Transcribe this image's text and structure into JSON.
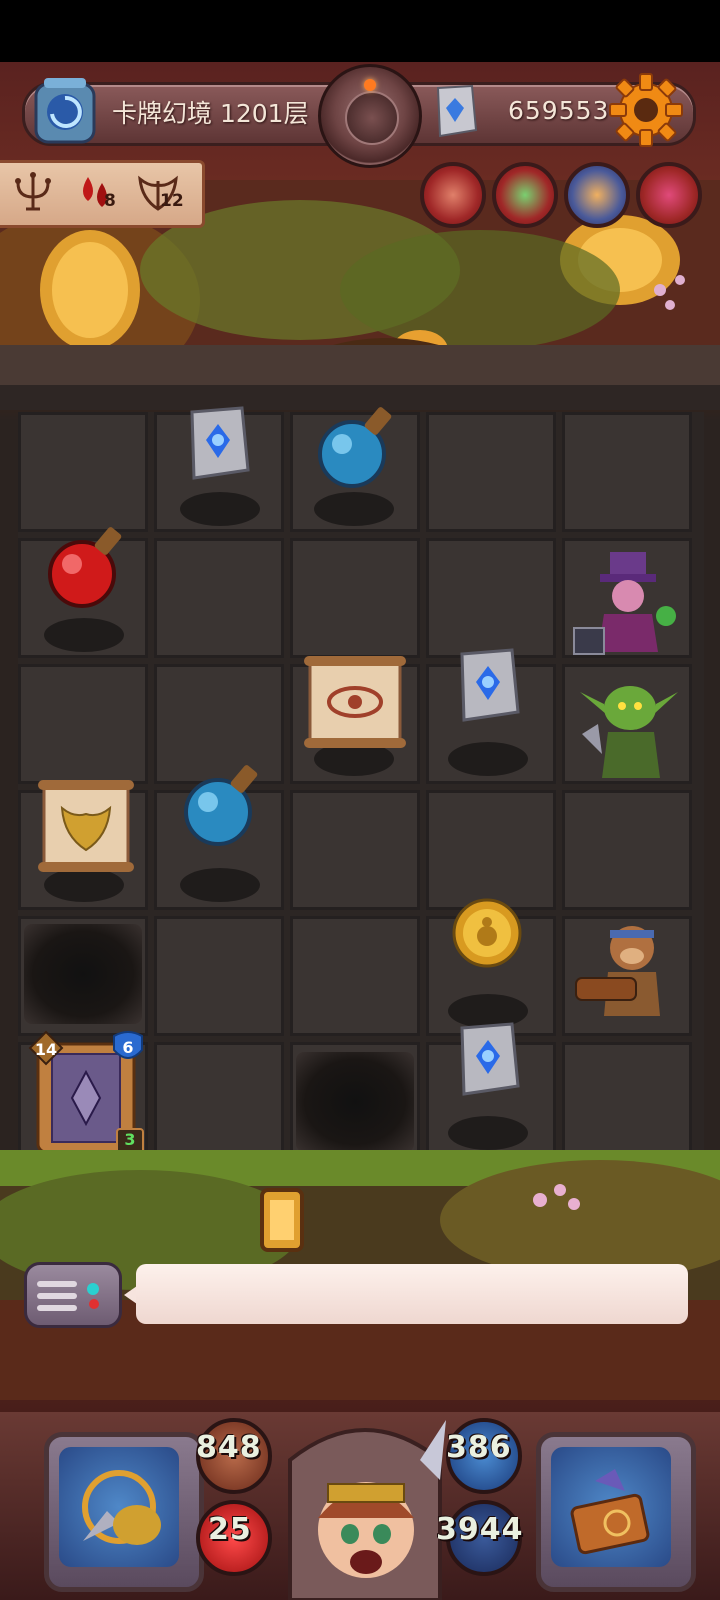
{
  "header": {
    "level_title": "卡牌幻境 1201层",
    "currency_value": "659553"
  },
  "resources": {
    "blood_count": "8",
    "wings_count": "12"
  },
  "heroes_top": [
    "hero-portrait-1",
    "hero-portrait-2",
    "hero-portrait-3",
    "hero-portrait-4"
  ],
  "deck_card": {
    "attack": "14",
    "shield": "6",
    "count": "3"
  },
  "player_stats": {
    "attack": "848",
    "defense": "386",
    "hp": "25",
    "gold": "3944"
  },
  "chat": {
    "message": ""
  },
  "colors": {
    "attack_orb": "#8a3a2a",
    "defense_orb": "#2e5a8a",
    "hp_orb": "#c01820",
    "gold_orb": "#2a4a7a"
  }
}
